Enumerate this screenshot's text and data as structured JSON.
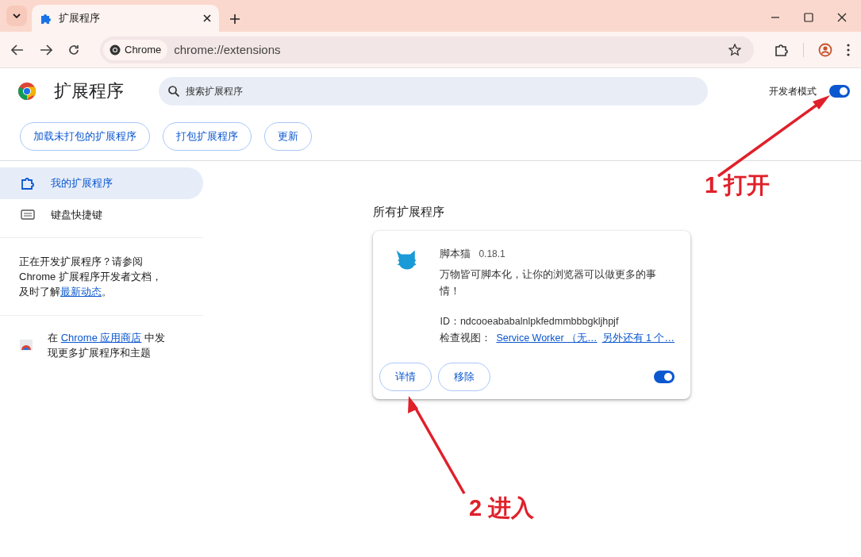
{
  "tab": {
    "title": "扩展程序"
  },
  "toolbar": {
    "chip": "Chrome",
    "url": "chrome://extensions"
  },
  "header": {
    "title": "扩展程序",
    "search": {
      "placeholder": "搜索扩展程序"
    },
    "developer_mode": {
      "label": "开发者模式",
      "on": true
    }
  },
  "actions": [
    "加载未打包的扩展程序",
    "打包扩展程序",
    "更新"
  ],
  "sidebar": {
    "items": [
      {
        "label": "我的扩展程序",
        "selected": true,
        "kind": "puzzle"
      },
      {
        "label": "键盘快捷键",
        "selected": false,
        "kind": "keyboard"
      }
    ],
    "dev_note": {
      "before": "正在开发扩展程序？请参阅 Chrome 扩展程序开发者文档，及时了解",
      "link": "最新动态",
      "after": "。"
    },
    "store_note": {
      "before": "在",
      "link": "Chrome 应用商店",
      "after": "中发现更多扩展程序和主题"
    }
  },
  "section_title": "所有扩展程序",
  "extensions": [
    {
      "name": "脚本猫",
      "version": "0.18.1",
      "description": "万物皆可脚本化，让你的浏览器可以做更多的事情！",
      "id": "ID：ndcooeababalnlpkfedmmbbbgkljhpjf",
      "inspect_label": "检查视图：",
      "inspect_links": [
        "Service Worker （无…",
        "另外还有 1 个…"
      ],
      "buttons": [
        "详情",
        "移除"
      ],
      "enabled": true
    }
  ],
  "annotations": [
    {
      "text": "1 打开",
      "kind": "upright"
    },
    {
      "text": "2 进入",
      "kind": "upleft"
    }
  ]
}
